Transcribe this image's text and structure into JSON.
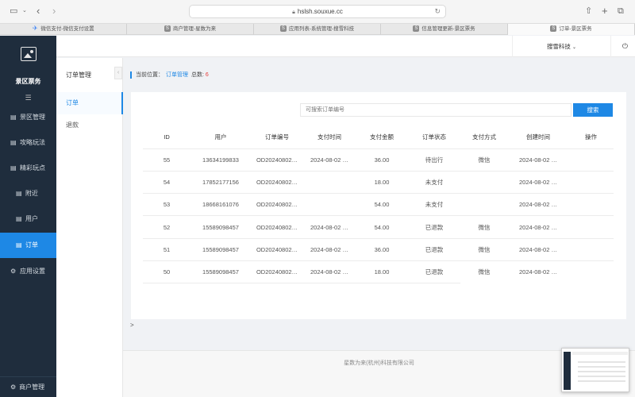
{
  "browser": {
    "url": "hslsh.souxue.cc",
    "tabs": [
      {
        "label": "微信支付-微信支付设置",
        "icon": "wechat-pay-icon"
      },
      {
        "label": "商户管理-星数为来",
        "icon": "s-icon"
      },
      {
        "label": "应用列表-系统管理-搜雪科技",
        "icon": "s-icon"
      },
      {
        "label": "信息管理更新-景区票务",
        "icon": "s-icon"
      },
      {
        "label": "订单-景区票务",
        "icon": "s-icon",
        "active": true
      }
    ]
  },
  "sidebar": {
    "brand": "景区票务",
    "items": [
      {
        "label": "景区管理",
        "icon": "document-icon"
      },
      {
        "label": "攻略玩法",
        "icon": "document-icon"
      },
      {
        "label": "精彩玩点",
        "icon": "document-icon"
      },
      {
        "label": "附近",
        "icon": "document-icon"
      },
      {
        "label": "用户",
        "icon": "document-icon"
      },
      {
        "label": "订单",
        "icon": "document-icon",
        "active": true
      },
      {
        "label": "应用设置",
        "icon": "gear-icon"
      }
    ],
    "footer": "商户管理"
  },
  "header": {
    "company": "搜雪科技"
  },
  "subnav": {
    "title": "订单管理",
    "items": [
      "订单",
      "退款"
    ]
  },
  "breadcrumb": {
    "prefix": "当前位置：",
    "current": "订单管理",
    "total_label": "总数:",
    "total": "6"
  },
  "search": {
    "placeholder": "可搜索订单编号",
    "button": "搜索"
  },
  "table": {
    "headers": [
      "ID",
      "用户",
      "订单编号",
      "支付时间",
      "支付金额",
      "订单状态",
      "支付方式",
      "创建时间",
      "操作"
    ],
    "rows": [
      [
        "55",
        "13634199833",
        "OD20240802…",
        "2024-08-02 …",
        "36.00",
        "待出行",
        "微信",
        "2024-08-02 …",
        ""
      ],
      [
        "54",
        "17852177156",
        "OD20240802…",
        "",
        "18.00",
        "未支付",
        "",
        "2024-08-02 …",
        ""
      ],
      [
        "53",
        "18668161076",
        "OD20240802…",
        "",
        "54.00",
        "未支付",
        "",
        "2024-08-02 …",
        ""
      ],
      [
        "52",
        "15589098457",
        "OD20240802…",
        "2024-08-02 …",
        "54.00",
        "已退款",
        "微信",
        "2024-08-02 …",
        ""
      ],
      [
        "51",
        "15589098457",
        "OD20240802…",
        "2024-08-02 …",
        "36.00",
        "已退款",
        "微信",
        "2024-08-02 …",
        ""
      ],
      [
        "50",
        "15589098457",
        "OD20240802…",
        "2024-08-02 …",
        "18.00",
        "已退款",
        "微信",
        "2024-08-02 …",
        ""
      ]
    ]
  },
  "footer": "星数为来(杭州)科技有限公司",
  "colors": {
    "sidebar_bg": "#1f2d3d",
    "accent": "#1e88e5",
    "count": "#e53935"
  }
}
